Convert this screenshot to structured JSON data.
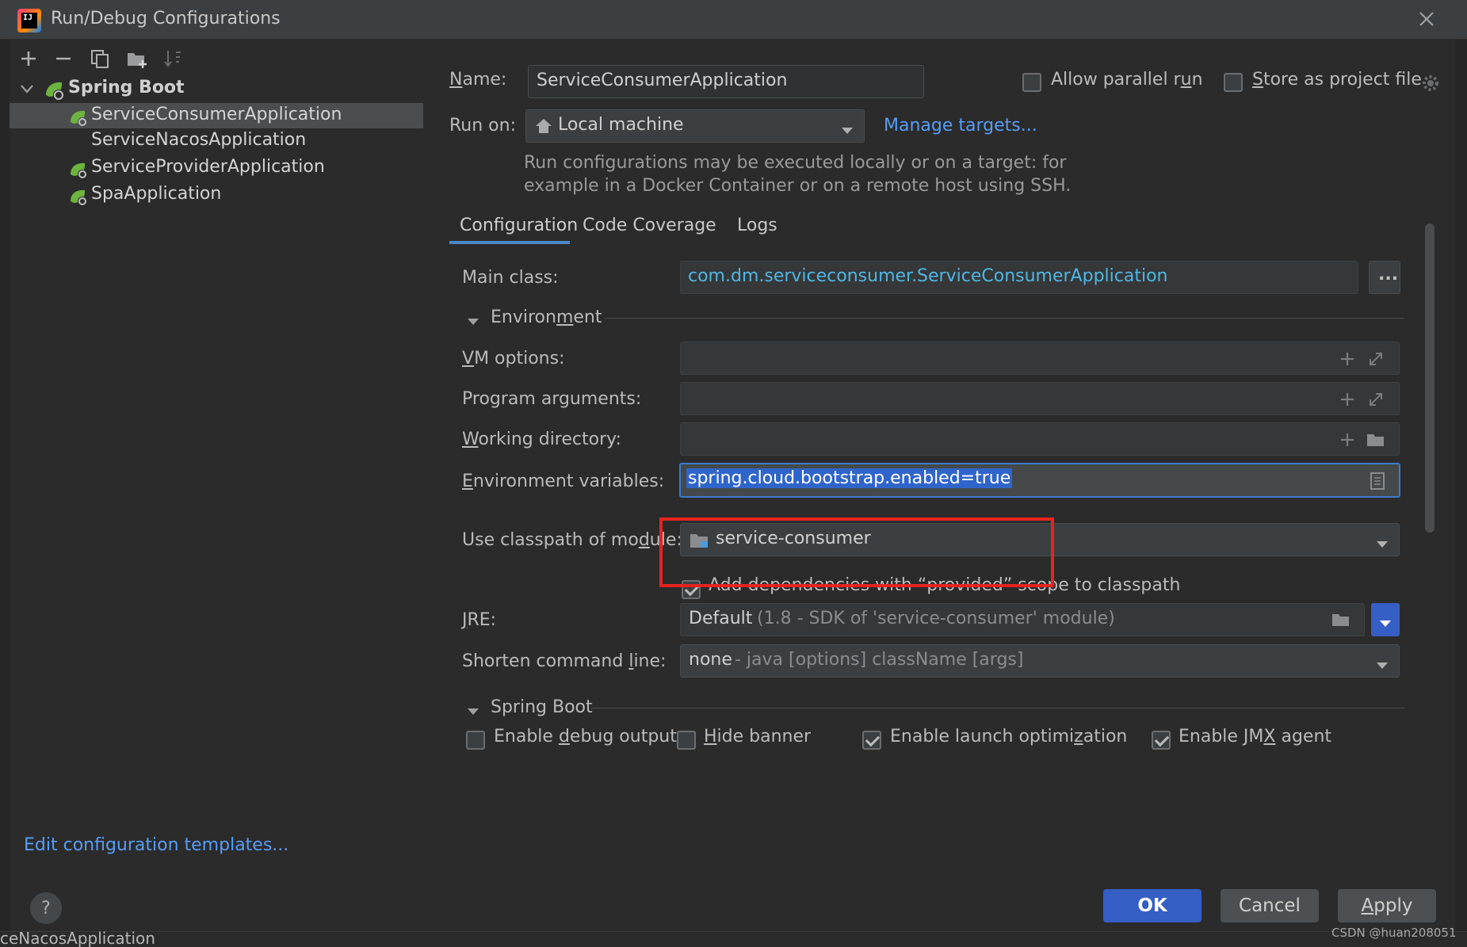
{
  "window": {
    "title": "Run/Debug Configurations",
    "app_icon": "intellij-app-icon"
  },
  "toolbar": {
    "icons": [
      "add-icon",
      "remove-icon",
      "copy-icon",
      "folder-add-icon",
      "sort-icon"
    ]
  },
  "tree": {
    "group": "Spring Boot",
    "items": [
      {
        "label": "ServiceConsumerApplication",
        "selected": true,
        "icon": "spring-boot-run-icon"
      },
      {
        "label": "ServiceNacosApplication",
        "selected": false,
        "icon": ""
      },
      {
        "label": "ServiceProviderApplication",
        "selected": false,
        "icon": "spring-boot-run-icon"
      },
      {
        "label": "SpaApplication",
        "selected": false,
        "icon": "spring-boot-run-icon"
      }
    ]
  },
  "edit_templates_link": "Edit configuration templates...",
  "help_label": "?",
  "name": {
    "label_prefix": "",
    "label_underlined": "N",
    "label_rest": "ame:",
    "value": "ServiceConsumerApplication"
  },
  "allow_parallel": {
    "label_a": "Allow parallel r",
    "label_u": "u",
    "label_b": "n",
    "checked": false
  },
  "store_project": {
    "label_a": "",
    "label_u": "S",
    "label_b": "tore as project file",
    "checked": false
  },
  "run_on": {
    "label": "Run on:",
    "value": "Local machine",
    "manage_link": "Manage targets...",
    "hint_line1": "Run configurations may be executed locally or on a target: for",
    "hint_line2": "example in a Docker Container or on a remote host using SSH."
  },
  "tabs": [
    {
      "label": "Configuration",
      "active": true
    },
    {
      "label": "Code Coverage",
      "active": false
    },
    {
      "label": "Logs",
      "active": false
    }
  ],
  "main_class": {
    "label": "Main class:",
    "value": "com.dm.serviceconsumer.ServiceConsumerApplication",
    "browse_label": "..."
  },
  "environment_section": {
    "label_a": "Environ",
    "label_u": "m",
    "label_b": "ent"
  },
  "vm_options": {
    "label_u": "V",
    "label_rest": "M options:",
    "value": ""
  },
  "program_args": {
    "label": "Program arguments:",
    "value": ""
  },
  "working_dir": {
    "label_u": "W",
    "label_rest": "orking directory:",
    "value": ""
  },
  "env_vars": {
    "label_u": "E",
    "label_rest": "nvironment variables:",
    "value": "spring.cloud.bootstrap.enabled=true",
    "highlight_color": "#e8231f"
  },
  "classpath_module": {
    "label_a": "Use classpath of mo",
    "label_u": "d",
    "label_b": "ule:",
    "value": "service-consumer",
    "provided_scope_label": "Add dependencies with “provided” scope to classpath",
    "provided_scope_checked": true
  },
  "jre": {
    "label_u": "J",
    "label_rest": "RE:",
    "value_main": "Default",
    "value_detail": "(1.8 - SDK of 'service-consumer' module)"
  },
  "shorten_cmd": {
    "label_a": "Shorten command ",
    "label_u": "l",
    "label_b": "ine:",
    "value_main": "none",
    "value_detail": "- java [options] className [args]"
  },
  "spring_boot_section": {
    "label": "Spring Boot",
    "options": [
      {
        "label_a": "Enable ",
        "label_u": "d",
        "label_b": "ebug output",
        "checked": false
      },
      {
        "label_a": "",
        "label_u": "H",
        "label_b": "ide banner",
        "checked": false
      },
      {
        "label_a": "Enable launch optimi",
        "label_u": "z",
        "label_b": "ation",
        "checked": true
      },
      {
        "label_a": "Enable JM",
        "label_u": "X",
        "label_b": " agent",
        "checked": true
      }
    ]
  },
  "buttons": {
    "ok": "OK",
    "cancel": "Cancel",
    "apply_u": "A",
    "apply_rest": "pply"
  },
  "background_text": {
    "bottom_left": "ceNacosApplication",
    "watermark": "CSDN @huan208051"
  },
  "colors": {
    "accent": "#365880",
    "ok_button": "#365fc5",
    "link": "#589df6",
    "tab_underline": "#4a88c7"
  }
}
